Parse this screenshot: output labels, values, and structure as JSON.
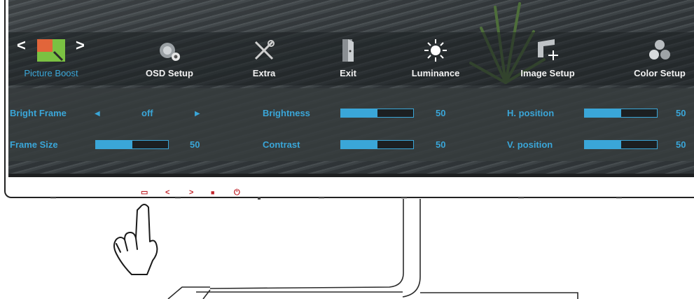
{
  "menu": {
    "nav_left": "<",
    "nav_right": ">",
    "items": [
      {
        "label": "Picture Boost",
        "icon": "picture-boost-icon",
        "active": true
      },
      {
        "label": "OSD Setup",
        "icon": "osd-setup-icon"
      },
      {
        "label": "Extra",
        "icon": "extra-tools-icon"
      },
      {
        "label": "Exit",
        "icon": "exit-door-icon"
      },
      {
        "label": "Luminance",
        "icon": "luminance-sun-icon"
      },
      {
        "label": "Image Setup",
        "icon": "image-setup-icon"
      },
      {
        "label": "Color Setup",
        "icon": "color-setup-icon"
      }
    ]
  },
  "settings": {
    "bright_frame": {
      "label": "Bright Frame",
      "value": "off"
    },
    "frame_size": {
      "label": "Frame Size",
      "value": "50",
      "level": 0.5
    },
    "brightness": {
      "label": "Brightness",
      "value": "50",
      "level": 0.5
    },
    "contrast": {
      "label": "Contrast",
      "value": "50",
      "level": 0.5
    },
    "h_position": {
      "label": "H. position",
      "value": "50",
      "level": 0.5
    },
    "v_position": {
      "label": "V. position",
      "value": "50",
      "level": 0.5
    }
  },
  "bezel_buttons": [
    {
      "glyph": "▭",
      "icon": "menu-button-icon"
    },
    {
      "glyph": "<",
      "icon": "left-button-icon"
    },
    {
      "glyph": ">",
      "icon": "right-button-icon"
    },
    {
      "glyph": "■",
      "icon": "source-button-icon"
    },
    {
      "glyph": "⏻",
      "icon": "power-button-icon"
    }
  ],
  "colors": {
    "accent": "#3aa6d8",
    "button_red": "#c0242b"
  }
}
